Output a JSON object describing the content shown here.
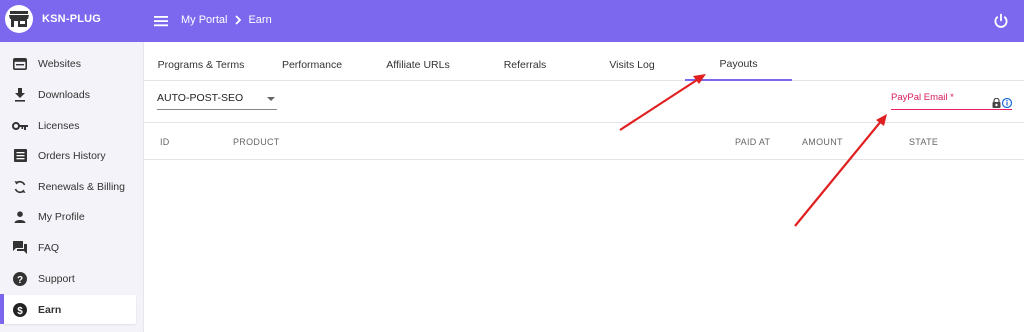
{
  "colors": {
    "brand": "#7b68ee",
    "required": "#d81b60",
    "arrow": "#e02020"
  },
  "brand": {
    "name": "KSN-PLUG",
    "icon": "storefront-icon"
  },
  "breadcrumb": {
    "home": "My Portal",
    "current": "Earn"
  },
  "sidebar": {
    "items": [
      {
        "label": "Websites",
        "icon": "browser-icon"
      },
      {
        "label": "Downloads",
        "icon": "download-icon"
      },
      {
        "label": "Licenses",
        "icon": "key-icon"
      },
      {
        "label": "Orders History",
        "icon": "list-icon"
      },
      {
        "label": "Renewals & Billing",
        "icon": "refresh-icon"
      },
      {
        "label": "My Profile",
        "icon": "person-icon"
      },
      {
        "label": "FAQ",
        "icon": "forum-icon"
      },
      {
        "label": "Support",
        "icon": "help-icon"
      },
      {
        "label": "Earn",
        "icon": "dollar-icon",
        "active": true
      }
    ]
  },
  "tabs": [
    {
      "label": "Programs & Terms"
    },
    {
      "label": "Performance"
    },
    {
      "label": "Affiliate URLs"
    },
    {
      "label": "Referrals"
    },
    {
      "label": "Visits Log"
    },
    {
      "label": "Payouts",
      "active": true
    }
  ],
  "filters": {
    "program_select": {
      "value": "AUTO-POST-SEO"
    },
    "paypal_email": {
      "label": "PayPal Email *",
      "value": ""
    }
  },
  "table": {
    "columns": [
      "ID",
      "PRODUCT",
      "PAID AT",
      "AMOUNT",
      "STATE"
    ]
  }
}
